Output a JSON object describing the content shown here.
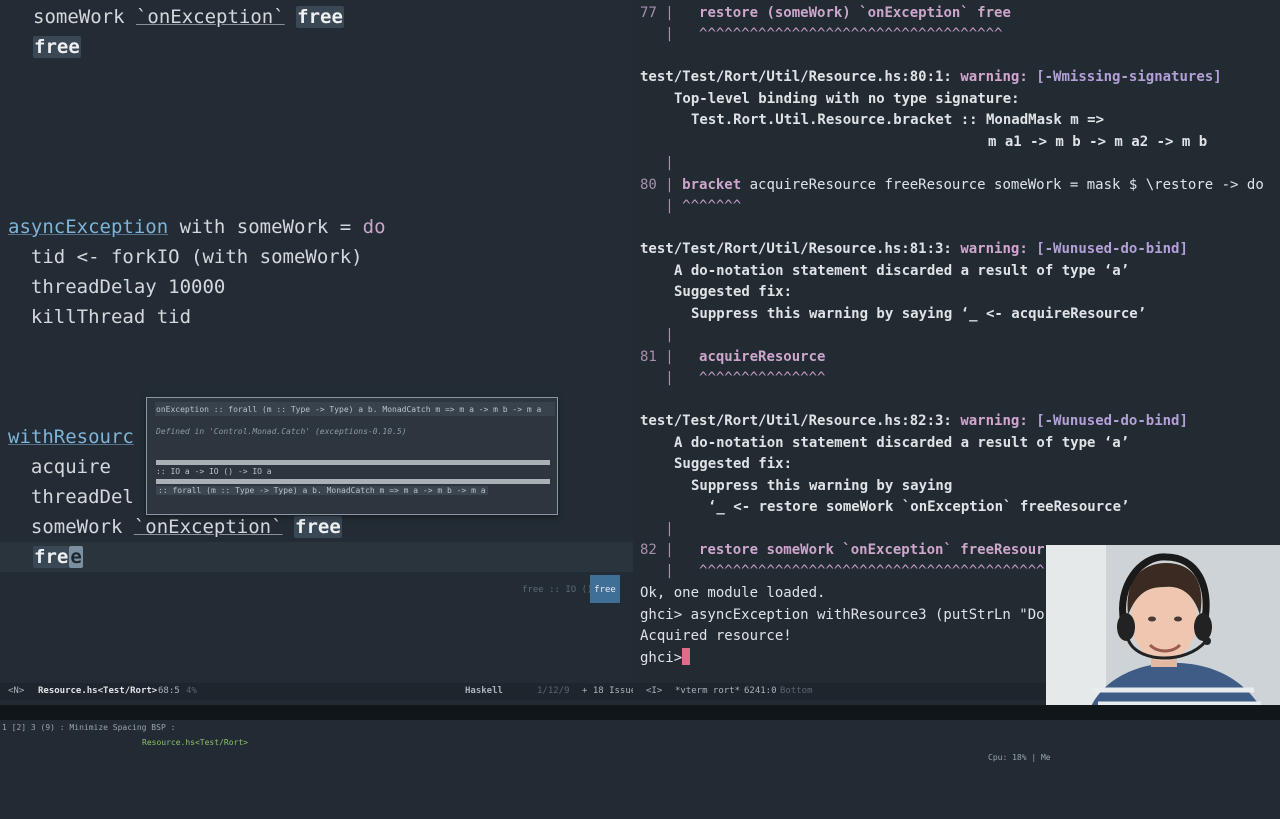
{
  "editor": {
    "lines": {
      "l1_a": "someWork ",
      "l1_b": "`onException`",
      "l1_c": " ",
      "l1_d": "free",
      "l2": "free",
      "l3_fn": "asyncException",
      "l3_rest": " with someWork = ",
      "l3_kw": "do",
      "l4": "  tid <- forkIO (with someWork)",
      "l5": "  threadDelay 10000",
      "l6": "  killThread tid",
      "l7_fn": "withResourc",
      "l8": "  acquire",
      "l9": "  threadDel",
      "l10_a": "  someWork ",
      "l10_b": "`onException`",
      "l10_c": " ",
      "l10_d": "free",
      "l11_a": "fre",
      "l11_b": "e"
    },
    "hover": {
      "signature": "onException :: forall (m :: Type -> Type) a b. MonadCatch m => m a -> m b -> m a",
      "defined_in": "Defined in 'Control.Monad.Catch' (exceptions-0.10.5)",
      "sig2": ":: IO a -> IO () -> IO a",
      "sig3": ":: forall (m :: Type -> Type) a b. MonadCatch m => m a -> m b -> m a"
    },
    "completion": {
      "muted": "free :: IO ()",
      "selected": "free"
    }
  },
  "terminal": {
    "w0_num": "77",
    "w0_code": "restore (someWork) `onException` free",
    "w0_carets": "^^^^^^^^^^^^^^^^^^^^^^^^^^^^^^^^^^^^",
    "w1_loc": "test/Test/Rort/Util/Resource.hs:80:1:",
    "w1_warn": "warning:",
    "w1_flag": "[-Wmissing-signatures]",
    "w1_l1": "Top-level binding with no type signature:",
    "w1_l2": "Test.Rort.Util.Resource.bracket :: MonadMask m =>",
    "w1_l3": "m a1 -> m b -> m a2 -> m b",
    "w1_num": "80",
    "w1_code_kw": "bracket",
    "w1_code": " acquireResource freeResource someWork = mask $ \\restore -> do",
    "w1_carets": "^^^^^^^",
    "w2_loc": "test/Test/Rort/Util/Resource.hs:81:3:",
    "w2_warn": "warning:",
    "w2_flag": "[-Wunused-do-bind]",
    "w2_l1": "A do-notation statement discarded a result of type ‘a’",
    "w2_l2": "Suggested fix:",
    "w2_l3": "Suppress this warning by saying ‘_ <- acquireResource’",
    "w2_num": "81",
    "w2_code": "acquireResource",
    "w2_carets": "^^^^^^^^^^^^^^^",
    "w3_loc": "test/Test/Rort/Util/Resource.hs:82:3:",
    "w3_warn": "warning:",
    "w3_flag": "[-Wunused-do-bind]",
    "w3_l1": "A do-notation statement discarded a result of type ‘a’",
    "w3_l2": "Suggested fix:",
    "w3_l3": "Suppress this warning by saying",
    "w3_l4": "‘_ <- restore someWork `onException` freeResource’",
    "w3_num": "82",
    "w3_code": "restore someWork `onException` freeResour",
    "w3_carets": "^^^^^^^^^^^^^^^^^^^^^^^^^^^^^^^^^^^^^^^^^",
    "loaded": "Ok, one module loaded.",
    "cmd": "ghci> asyncException withResource3 (putStrLn \"Do",
    "acquired": "Acquired resource!",
    "prompt": "ghci>"
  },
  "modeline_left": {
    "state": "<N>",
    "buffer": "Resource.hs<Test/Rort>",
    "position": "68:5",
    "extra": "4%",
    "mode": "Haskell",
    "vcs": "1/12/9",
    "issues": "+ 18 Issues"
  },
  "modeline_right": {
    "state": "<I>",
    "buffer": "*vterm rort*",
    "position": "6241:0",
    "extra": "Bottom"
  },
  "statusbar": {
    "workspaces": "1 [2] 3 (9) : Minimize Spacing BSP : ",
    "title": "Resource.hs<Test/Rort>",
    "cpu": "Cpu: 18% | Me"
  },
  "colors": {
    "editor_bg": "#232c34",
    "terminal_bg": "#222a32",
    "keyword": "#c9a6c8",
    "function": "#7fb3d8",
    "warning": "#d3a6cf",
    "cursor": "#e06c8a",
    "selection": "#3f6f97"
  }
}
